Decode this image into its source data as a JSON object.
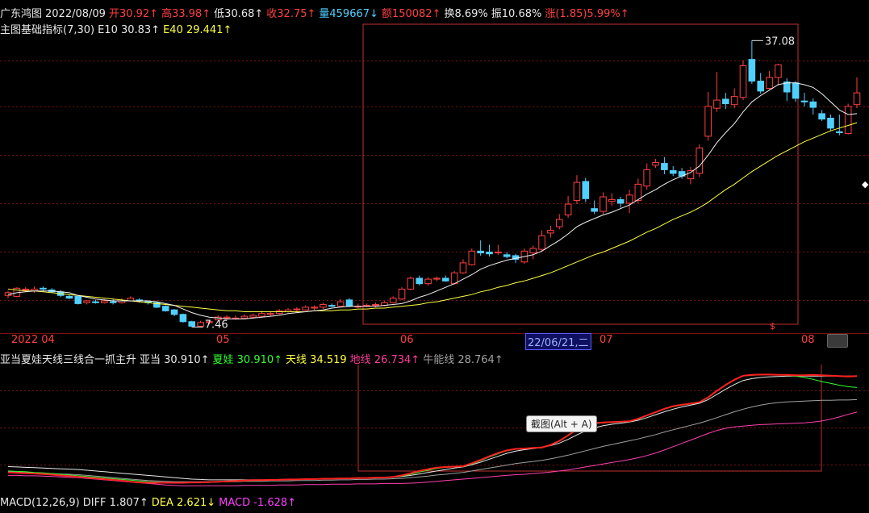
{
  "info_bar": {
    "stock_name": "广东鸿图",
    "date": "2022/08/09",
    "open": "开30.92↑",
    "high": "高33.98↑",
    "low": "低30.68↑",
    "close": "收32.75↑",
    "volume": "量459667↓",
    "amount": "额150082↑",
    "turnover": "换8.69%",
    "amplitude": "振10.68%",
    "change": "涨(1.85)5.99%↑"
  },
  "indicator_bar": {
    "name": "主图基础指标(7,30)",
    "e10": "E10 30.83↑",
    "e40": "E40 29.441↑"
  },
  "price_labels": {
    "high_label": "37.08",
    "low_label": "7.46"
  },
  "time_axis": {
    "labels": [
      "2022 04",
      "05",
      "06",
      "07",
      "08"
    ],
    "selected_date": "22/06/21,二",
    "dollar_mark": "$"
  },
  "sub_indicator_bar": {
    "name": "亚当夏娃天线三线合一抓主升",
    "adam": "亚当 30.910↑",
    "eve": "夏娃 30.910↑",
    "sky": "天线 34.519",
    "earth": "地线 26.734↑",
    "bull": "牛能线 28.764↑"
  },
  "tooltip": "截图(Alt + A)",
  "macd_bar": {
    "name": "MACD(12,26,9)",
    "diff": "DIFF 1.807↑",
    "dea": "DEA 2.621↓",
    "macd": "MACD -1.628↑"
  },
  "colors": {
    "up": "#ff4040",
    "down": "#50d0ff",
    "ma_short": "#ffffff",
    "ma_long": "#ffff40",
    "grid": "#7a1010",
    "eve": "#30ff30",
    "adam": "#ff2020",
    "earth": "#ff40b0",
    "bull": "#a0a0a0"
  },
  "chart_data": {
    "type": "candlestick",
    "title": "",
    "ylim": [
      5,
      38
    ],
    "candles": [
      {
        "o": 8.9,
        "c": 9.2,
        "h": 9.4,
        "l": 8.6
      },
      {
        "o": 8.8,
        "c": 9.7,
        "h": 9.8,
        "l": 8.7
      },
      {
        "o": 9.5,
        "c": 9.6,
        "h": 9.8,
        "l": 9.3
      },
      {
        "o": 9.4,
        "c": 9.6,
        "h": 9.9,
        "l": 9.2
      },
      {
        "o": 9.7,
        "c": 9.6,
        "h": 9.9,
        "l": 9.4
      },
      {
        "o": 9.5,
        "c": 9.3,
        "h": 9.7,
        "l": 9.2
      },
      {
        "o": 9.3,
        "c": 8.9,
        "h": 9.5,
        "l": 8.7
      },
      {
        "o": 8.8,
        "c": 8.6,
        "h": 9.0,
        "l": 8.5
      },
      {
        "o": 8.8,
        "c": 8.0,
        "h": 8.9,
        "l": 7.9
      },
      {
        "o": 8.1,
        "c": 8.3,
        "h": 8.4,
        "l": 7.9
      },
      {
        "o": 8.2,
        "c": 8.1,
        "h": 8.4,
        "l": 8.0
      },
      {
        "o": 8.1,
        "c": 8.3,
        "h": 8.5,
        "l": 8.0
      },
      {
        "o": 8.2,
        "c": 8.1,
        "h": 8.5,
        "l": 7.9
      },
      {
        "o": 8.1,
        "c": 8.3,
        "h": 8.6,
        "l": 8.0
      },
      {
        "o": 8.3,
        "c": 8.6,
        "h": 8.8,
        "l": 8.2
      },
      {
        "o": 8.4,
        "c": 8.3,
        "h": 8.6,
        "l": 8.1
      },
      {
        "o": 8.2,
        "c": 8.1,
        "h": 8.3,
        "l": 7.9
      },
      {
        "o": 8.1,
        "c": 7.6,
        "h": 8.2,
        "l": 7.5
      },
      {
        "o": 7.7,
        "c": 7.2,
        "h": 7.8,
        "l": 7.1
      },
      {
        "o": 7.3,
        "c": 6.8,
        "h": 7.4,
        "l": 6.6
      },
      {
        "o": 6.8,
        "c": 6.0,
        "h": 6.9,
        "l": 5.9
      },
      {
        "o": 6.0,
        "c": 5.5,
        "h": 6.1,
        "l": 5.4
      },
      {
        "o": 5.5,
        "c": 5.9,
        "h": 6.1,
        "l": 5.4
      },
      {
        "o": 5.9,
        "c": 6.0,
        "h": 6.2,
        "l": 5.7
      },
      {
        "o": 6.2,
        "c": 6.5,
        "h": 6.7,
        "l": 6.0
      },
      {
        "o": 6.4,
        "c": 6.5,
        "h": 6.7,
        "l": 6.2
      },
      {
        "o": 6.3,
        "c": 6.4,
        "h": 6.7,
        "l": 6.2
      },
      {
        "o": 6.4,
        "c": 6.6,
        "h": 6.8,
        "l": 6.3
      },
      {
        "o": 6.5,
        "c": 6.7,
        "h": 6.9,
        "l": 6.3
      },
      {
        "o": 6.6,
        "c": 6.9,
        "h": 7.2,
        "l": 6.5
      },
      {
        "o": 6.8,
        "c": 6.9,
        "h": 7.1,
        "l": 6.6
      },
      {
        "o": 6.9,
        "c": 7.2,
        "h": 7.4,
        "l": 6.8
      },
      {
        "o": 7.1,
        "c": 7.3,
        "h": 7.5,
        "l": 7.0
      },
      {
        "o": 7.3,
        "c": 7.4,
        "h": 7.6,
        "l": 7.1
      },
      {
        "o": 7.3,
        "c": 7.6,
        "h": 7.8,
        "l": 7.2
      },
      {
        "o": 7.5,
        "c": 7.6,
        "h": 7.8,
        "l": 7.3
      },
      {
        "o": 7.6,
        "c": 7.9,
        "h": 8.1,
        "l": 7.4
      },
      {
        "o": 7.8,
        "c": 7.7,
        "h": 8.0,
        "l": 7.6
      },
      {
        "o": 7.7,
        "c": 8.2,
        "h": 8.5,
        "l": 7.6
      },
      {
        "o": 8.4,
        "c": 7.7,
        "h": 8.6,
        "l": 7.6
      },
      {
        "o": 7.7,
        "c": 7.7,
        "h": 8.0,
        "l": 7.5
      },
      {
        "o": 7.7,
        "c": 7.8,
        "h": 8.0,
        "l": 7.6
      },
      {
        "o": 7.8,
        "c": 7.9,
        "h": 8.1,
        "l": 7.6
      },
      {
        "o": 7.8,
        "c": 8.1,
        "h": 8.3,
        "l": 7.7
      },
      {
        "o": 8.1,
        "c": 8.6,
        "h": 8.8,
        "l": 8.0
      },
      {
        "o": 8.5,
        "c": 9.6,
        "h": 9.8,
        "l": 8.4
      },
      {
        "o": 9.6,
        "c": 10.8,
        "h": 11.0,
        "l": 9.5
      },
      {
        "o": 10.8,
        "c": 10.2,
        "h": 11.1,
        "l": 10.0
      },
      {
        "o": 10.2,
        "c": 10.7,
        "h": 10.9,
        "l": 10.0
      },
      {
        "o": 10.7,
        "c": 10.8,
        "h": 11.0,
        "l": 10.5
      },
      {
        "o": 10.8,
        "c": 10.5,
        "h": 11.1,
        "l": 10.4
      },
      {
        "o": 10.2,
        "c": 11.4,
        "h": 11.6,
        "l": 10.1
      },
      {
        "o": 11.4,
        "c": 12.5,
        "h": 12.9,
        "l": 11.3
      },
      {
        "o": 12.3,
        "c": 13.8,
        "h": 14.1,
        "l": 12.2
      },
      {
        "o": 13.8,
        "c": 13.6,
        "h": 15.0,
        "l": 13.3
      },
      {
        "o": 13.7,
        "c": 13.5,
        "h": 14.5,
        "l": 13.2
      },
      {
        "o": 13.6,
        "c": 13.7,
        "h": 14.5,
        "l": 13.4
      },
      {
        "o": 13.4,
        "c": 13.2,
        "h": 13.7,
        "l": 13.0
      },
      {
        "o": 13.3,
        "c": 12.9,
        "h": 13.5,
        "l": 12.5
      },
      {
        "o": 12.6,
        "c": 13.8,
        "h": 14.1,
        "l": 12.4
      },
      {
        "o": 13.6,
        "c": 14.1,
        "h": 14.4,
        "l": 12.9
      },
      {
        "o": 14.0,
        "c": 15.5,
        "h": 16.1,
        "l": 13.8
      },
      {
        "o": 15.8,
        "c": 16.1,
        "h": 16.6,
        "l": 15.3
      },
      {
        "o": 16.5,
        "c": 17.3,
        "h": 17.9,
        "l": 16.2
      },
      {
        "o": 17.8,
        "c": 19.0,
        "h": 19.9,
        "l": 17.5
      },
      {
        "o": 19.4,
        "c": 21.4,
        "h": 22.2,
        "l": 19.0
      },
      {
        "o": 21.5,
        "c": 19.6,
        "h": 21.9,
        "l": 19.2
      },
      {
        "o": 18.5,
        "c": 18.2,
        "h": 19.4,
        "l": 17.9
      },
      {
        "o": 18.2,
        "c": 19.8,
        "h": 20.3,
        "l": 17.9
      },
      {
        "o": 19.3,
        "c": 19.5,
        "h": 20.2,
        "l": 18.8
      },
      {
        "o": 19.5,
        "c": 19.1,
        "h": 19.8,
        "l": 18.6
      },
      {
        "o": 19.1,
        "c": 20.0,
        "h": 20.6,
        "l": 18.0
      },
      {
        "o": 19.4,
        "c": 21.2,
        "h": 21.8,
        "l": 19.1
      },
      {
        "o": 21.0,
        "c": 22.8,
        "h": 23.5,
        "l": 20.6
      },
      {
        "o": 23.3,
        "c": 23.6,
        "h": 24.0,
        "l": 23.0
      },
      {
        "o": 23.5,
        "c": 22.8,
        "h": 24.2,
        "l": 22.3
      },
      {
        "o": 22.7,
        "c": 22.4,
        "h": 23.2,
        "l": 22.1
      },
      {
        "o": 22.6,
        "c": 22.1,
        "h": 23.0,
        "l": 21.8
      },
      {
        "o": 21.8,
        "c": 22.7,
        "h": 23.1,
        "l": 21.2
      },
      {
        "o": 22.4,
        "c": 25.2,
        "h": 25.6,
        "l": 22.0
      },
      {
        "o": 26.5,
        "c": 29.8,
        "h": 31.4,
        "l": 26.0
      },
      {
        "o": 29.6,
        "c": 30.5,
        "h": 33.6,
        "l": 29.2
      },
      {
        "o": 30.6,
        "c": 30.1,
        "h": 31.3,
        "l": 29.5
      },
      {
        "o": 30.0,
        "c": 30.9,
        "h": 31.8,
        "l": 29.6
      },
      {
        "o": 30.8,
        "c": 34.3,
        "h": 34.9,
        "l": 30.5
      },
      {
        "o": 35.0,
        "c": 32.6,
        "h": 37.08,
        "l": 32.3
      },
      {
        "o": 32.6,
        "c": 31.5,
        "h": 33.5,
        "l": 31.2
      },
      {
        "o": 31.8,
        "c": 33.0,
        "h": 33.7,
        "l": 31.7
      },
      {
        "o": 33.0,
        "c": 34.4,
        "h": 34.5,
        "l": 32.1
      },
      {
        "o": 32.5,
        "c": 31.4,
        "h": 32.9,
        "l": 30.4
      },
      {
        "o": 32.4,
        "c": 30.7,
        "h": 32.6,
        "l": 30.3
      },
      {
        "o": 30.4,
        "c": 30.3,
        "h": 31.3,
        "l": 29.8
      },
      {
        "o": 30.3,
        "c": 29.7,
        "h": 30.7,
        "l": 28.9
      },
      {
        "o": 29.0,
        "c": 28.4,
        "h": 29.4,
        "l": 28.2
      },
      {
        "o": 28.5,
        "c": 27.4,
        "h": 28.9,
        "l": 27.1
      },
      {
        "o": 27.0,
        "c": 26.9,
        "h": 28.9,
        "l": 26.6
      },
      {
        "o": 26.8,
        "c": 29.8,
        "h": 30.1,
        "l": 26.7
      },
      {
        "o": 30.0,
        "c": 31.3,
        "h": 33.0,
        "l": 29.6
      }
    ],
    "ma_short": [
      9.0,
      9.2,
      9.3,
      9.4,
      9.4,
      9.4,
      9.3,
      9.2,
      8.9,
      8.7,
      8.5,
      8.4,
      8.3,
      8.3,
      8.3,
      8.3,
      8.3,
      8.2,
      8.0,
      7.8,
      7.4,
      7.0,
      6.7,
      6.5,
      6.4,
      6.3,
      6.3,
      6.3,
      6.4,
      6.5,
      6.6,
      6.7,
      6.9,
      7.0,
      7.1,
      7.2,
      7.3,
      7.5,
      7.6,
      7.7,
      7.7,
      7.7,
      7.7,
      7.8,
      7.9,
      8.0,
      8.3,
      8.7,
      9.0,
      9.4,
      9.8,
      10.2,
      10.7,
      11.2,
      11.8,
      12.2,
      12.5,
      12.8,
      13.0,
      13.2,
      13.4,
      13.8,
      14.4,
      15.0,
      15.7,
      16.5,
      17.0,
      17.4,
      17.8,
      18.1,
      18.5,
      18.9,
      19.5,
      20.1,
      20.6,
      21.2,
      21.7,
      22.1,
      22.5,
      23.2,
      24.4,
      25.8,
      26.9,
      27.9,
      29.2,
      30.3,
      31.0,
      31.6,
      32.2,
      32.4,
      32.4,
      32.2,
      31.9,
      31.2,
      30.3,
      29.4,
      28.9,
      29.0
    ],
    "ma_long": [
      9.6,
      9.5,
      9.4,
      9.4,
      9.3,
      9.2,
      9.1,
      9.0,
      8.9,
      8.8,
      8.7,
      8.6,
      8.5,
      8.4,
      8.3,
      8.2,
      8.1,
      8.0,
      7.9,
      7.8,
      7.7,
      7.6,
      7.5,
      7.4,
      7.3,
      7.2,
      7.2,
      7.1,
      7.1,
      7.1,
      7.1,
      7.1,
      7.1,
      7.1,
      7.1,
      7.2,
      7.2,
      7.2,
      7.3,
      7.3,
      7.4,
      7.4,
      7.5,
      7.5,
      7.6,
      7.7,
      7.8,
      7.9,
      8.1,
      8.2,
      8.4,
      8.6,
      8.8,
      9.0,
      9.3,
      9.5,
      9.8,
      10.0,
      10.3,
      10.5,
      10.8,
      11.1,
      11.4,
      11.8,
      12.2,
      12.6,
      13.0,
      13.4,
      13.7,
      14.1,
      14.5,
      14.9,
      15.4,
      15.9,
      16.3,
      16.8,
      17.3,
      17.7,
      18.1,
      18.6,
      19.2,
      19.9,
      20.6,
      21.2,
      21.9,
      22.6,
      23.2,
      23.8,
      24.4,
      24.9,
      25.4,
      25.9,
      26.3,
      26.7,
      27.1,
      27.4,
      27.7,
      28.0
    ],
    "sub_series": {
      "ylim": [
        5,
        37
      ],
      "adam": [
        9.0,
        8.9,
        8.8,
        8.7,
        8.6,
        8.4,
        8.2,
        8.0,
        7.8,
        7.6,
        7.4,
        7.2,
        7.0,
        6.8,
        6.5,
        6.3,
        6.2,
        6.2,
        6.2,
        6.2,
        6.2,
        6.3,
        6.3,
        6.4,
        6.5,
        6.6,
        6.7,
        6.8,
        6.9,
        6.9,
        7.0,
        7.0,
        7.1,
        7.1,
        7.2,
        7.2,
        7.3,
        7.3,
        7.4,
        7.4,
        7.5,
        7.5,
        7.6,
        7.6,
        7.8,
        8.2,
        8.8,
        9.4,
        9.9,
        10.3,
        10.5,
        10.6,
        10.7,
        11.5,
        12.4,
        13.4,
        14.3,
        15.0,
        15.4,
        15.5,
        15.7,
        15.8,
        16.5,
        17.6,
        19.1,
        20.7,
        21.8,
        22.4,
        22.6,
        22.7,
        22.8,
        22.9,
        23.6,
        24.5,
        25.4,
        26.3,
        27.0,
        27.4,
        27.7,
        28.1,
        29.4,
        31.2,
        32.8,
        34.2,
        35.3,
        35.5,
        35.6,
        35.6,
        35.5,
        35.5,
        35.4,
        35.4,
        35.5,
        35.4,
        35.3,
        35.2,
        35.1,
        35.2
      ],
      "eve": [
        9.4,
        9.3,
        9.2,
        9.0,
        8.9,
        8.7,
        8.5,
        8.3,
        8.1,
        7.9,
        7.7,
        7.5,
        7.3,
        7.1,
        6.9,
        6.7,
        6.5,
        6.4,
        6.3,
        6.2,
        6.2,
        6.2,
        6.3,
        6.3,
        6.4,
        6.5,
        6.6,
        6.7,
        6.8,
        6.8,
        6.9,
        7.0,
        7.0,
        7.1,
        7.1,
        7.2,
        7.2,
        7.3,
        7.3,
        7.4,
        7.4,
        7.5,
        7.5,
        7.6,
        7.7,
        8.0,
        8.5,
        9.1,
        9.6,
        10.1,
        10.4,
        10.5,
        10.6,
        11.3,
        12.2,
        13.2,
        14.1,
        14.9,
        15.3,
        15.4,
        15.6,
        15.7,
        16.4,
        17.5,
        19.0,
        20.6,
        21.7,
        22.3,
        22.5,
        22.6,
        22.7,
        22.8,
        23.5,
        24.4,
        25.3,
        26.2,
        26.9,
        27.3,
        27.6,
        28.0,
        29.3,
        31.1,
        32.7,
        34.1,
        35.2,
        35.4,
        35.5,
        35.6,
        35.5,
        35.4,
        35.2,
        34.8,
        34.3,
        33.7,
        33.2,
        32.7,
        32.3,
        32.1
      ],
      "sky": [
        10.6,
        10.5,
        10.4,
        10.3,
        10.2,
        10.1,
        10.0,
        9.9,
        9.8,
        9.6,
        9.4,
        9.2,
        9.0,
        8.8,
        8.6,
        8.4,
        8.2,
        8.0,
        7.8,
        7.6,
        7.4,
        7.2,
        7.1,
        7.0,
        7.0,
        7.0,
        7.0,
        7.0,
        7.0,
        7.0,
        7.0,
        7.1,
        7.1,
        7.1,
        7.2,
        7.2,
        7.3,
        7.3,
        7.4,
        7.4,
        7.5,
        7.5,
        7.6,
        7.6,
        7.7,
        7.9,
        8.2,
        8.6,
        9.0,
        9.4,
        9.8,
        10.2,
        10.5,
        11.1,
        11.8,
        12.6,
        13.4,
        14.2,
        14.8,
        15.2,
        15.5,
        15.8,
        16.3,
        17.0,
        18.0,
        19.2,
        20.3,
        21.1,
        21.7,
        22.1,
        22.4,
        22.7,
        23.2,
        23.9,
        24.7,
        25.5,
        26.2,
        26.8,
        27.3,
        27.8,
        28.8,
        30.2,
        31.6,
        32.9,
        34.0,
        34.5,
        34.8,
        35.0,
        35.1,
        35.2,
        35.2,
        35.2,
        35.2,
        35.2,
        35.2,
        35.2,
        35.2,
        35.2
      ],
      "earth": [
        8.2,
        8.2,
        8.1,
        8.1,
        8.0,
        7.9,
        7.8,
        7.7,
        7.6,
        7.4,
        7.2,
        7.0,
        6.8,
        6.6,
        6.4,
        6.2,
        6.0,
        5.8,
        5.6,
        5.5,
        5.4,
        5.4,
        5.4,
        5.4,
        5.4,
        5.4,
        5.4,
        5.5,
        5.5,
        5.5,
        5.5,
        5.6,
        5.6,
        5.6,
        5.7,
        5.7,
        5.7,
        5.8,
        5.8,
        5.8,
        5.9,
        5.9,
        5.9,
        6.0,
        6.0,
        6.0,
        6.1,
        6.2,
        6.4,
        6.6,
        6.8,
        7.0,
        7.2,
        7.4,
        7.6,
        7.8,
        8.0,
        8.2,
        8.4,
        8.5,
        8.7,
        8.9,
        9.1,
        9.4,
        9.7,
        10.1,
        10.5,
        10.9,
        11.3,
        11.7,
        12.1,
        12.5,
        13.0,
        13.6,
        14.3,
        15.1,
        16.0,
        16.9,
        17.8,
        18.7,
        19.6,
        20.4,
        21.0,
        21.4,
        21.6,
        21.8,
        22.0,
        22.1,
        22.2,
        22.3,
        22.4,
        22.5,
        22.7,
        23.0,
        23.5,
        24.1,
        24.8,
        25.4
      ],
      "bull": [
        9.2,
        9.1,
        9.0,
        8.9,
        8.8,
        8.7,
        8.6,
        8.5,
        8.4,
        8.2,
        8.0,
        7.8,
        7.6,
        7.4,
        7.2,
        7.0,
        6.8,
        6.7,
        6.6,
        6.5,
        6.5,
        6.5,
        6.5,
        6.5,
        6.5,
        6.5,
        6.5,
        6.6,
        6.6,
        6.6,
        6.7,
        6.7,
        6.7,
        6.8,
        6.8,
        6.8,
        6.9,
        6.9,
        7.0,
        7.0,
        7.1,
        7.1,
        7.2,
        7.2,
        7.3,
        7.4,
        7.6,
        7.8,
        8.0,
        8.3,
        8.5,
        8.8,
        9.0,
        9.4,
        9.8,
        10.2,
        10.6,
        11.0,
        11.4,
        11.7,
        12.0,
        12.3,
        12.7,
        13.2,
        13.7,
        14.3,
        14.9,
        15.5,
        16.1,
        16.6,
        17.1,
        17.6,
        18.1,
        18.7,
        19.3,
        20.0,
        20.6,
        21.2,
        21.8,
        22.4,
        23.1,
        23.9,
        24.7,
        25.5,
        26.2,
        26.8,
        27.3,
        27.7,
        28.0,
        28.2,
        28.3,
        28.4,
        28.5,
        28.6,
        28.6,
        28.7,
        28.7,
        28.8
      ]
    }
  }
}
